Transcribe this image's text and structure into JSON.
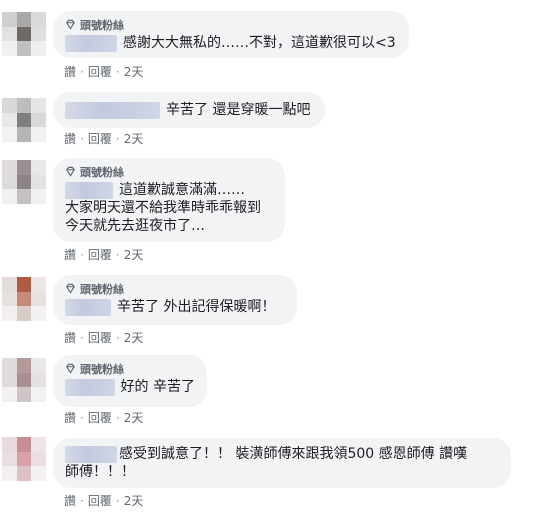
{
  "badge_label": "頭號粉絲",
  "action_like": "讚",
  "action_reply": "回覆",
  "separator": "·",
  "comments": [
    {
      "lines": [
        "感謝大大無私的……不對，這道歉很可以<3"
      ],
      "time": "2天"
    },
    {
      "lines": [
        "辛苦了 還是穿暖一點吧"
      ],
      "time": "2天"
    },
    {
      "lines": [
        "這道歉誠意滿滿……",
        "大家明天還不給我準時乖乖報到",
        "今天就先去逛夜市了…"
      ],
      "time": "2天"
    },
    {
      "lines": [
        "辛苦了 外出記得保暖啊！"
      ],
      "time": "2天"
    },
    {
      "lines": [
        "好的 辛苦了"
      ],
      "time": "2天"
    },
    {
      "lines": [
        "感受到誠意了！！ 裝潢師傅來跟我領500 感恩師傅 讚嘆",
        "師傅！！！"
      ],
      "time": "2天"
    }
  ],
  "avatar_colors": [
    [
      "#cfcfcf",
      "#a9a9a9",
      "#d9d9d9",
      "#e2e2e2",
      "#6f6a66",
      "#dedede",
      "#f1f1f1",
      "#bfbfbf",
      "#efefef"
    ],
    [
      "#d8d8d8",
      "#bdbdbd",
      "#e6e6e6",
      "#e8e8e8",
      "#7f7f7f",
      "#d9d9d9",
      "#f2f2f2",
      "#b5b5b5",
      "#f0f0f0"
    ],
    [
      "#e0dcdc",
      "#9c8f92",
      "#e8e8e8",
      "#dcdcdc",
      "#8e8486",
      "#e2e2e2",
      "#f0f0f0",
      "#c7c2c2",
      "#f1f1f1"
    ],
    [
      "#e4dcd9",
      "#b05c45",
      "#ece5e2",
      "#e6e2e0",
      "#c58a79",
      "#e7e1df",
      "#f2efee",
      "#d8cdc9",
      "#f3f1f0"
    ],
    [
      "#e0dada",
      "#b39b9c",
      "#e9e6e6",
      "#e1dbdb",
      "#a89092",
      "#e5e0e0",
      "#f2f0f0",
      "#cec5c6",
      "#f3f2f2"
    ],
    [
      "#e8dadd",
      "#c88e97",
      "#efe4e6",
      "#e9dfe1",
      "#d9a2aa",
      "#ecdde0",
      "#f3eeef",
      "#dcc2c7",
      "#f4f0f1"
    ]
  ]
}
